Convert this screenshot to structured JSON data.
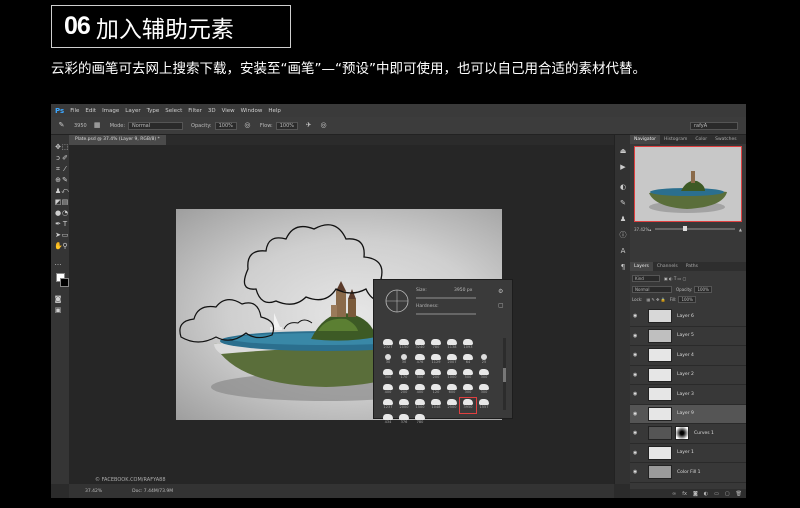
{
  "header": {
    "step_number": "06",
    "step_title": "加入辅助元素",
    "description": "云彩的画笔可去网上搜索下载，安装至“画笔”—“预设”中即可使用，也可以自己用合适的素材代替。"
  },
  "ps": {
    "logo": "Ps",
    "menu": [
      "File",
      "Edit",
      "Image",
      "Layer",
      "Type",
      "Select",
      "Filter",
      "3D",
      "View",
      "Window",
      "Help"
    ],
    "options": {
      "brush_size": "3950",
      "mode_label": "Mode:",
      "mode_value": "Normal",
      "opacity_label": "Opacity:",
      "opacity_value": "100%",
      "flow_label": "Flow:",
      "flow_value": "100%",
      "workspace": "rafyA"
    },
    "doc_tab": "Plate.psd @ 37.4% (Layer 9, RGB/8) *",
    "status": {
      "zoom": "37.42%",
      "doc_info": "Doc: 7.44M/73.9M"
    },
    "watermark": "© FACEBOOK.COM/RAFYA88",
    "brush_panel": {
      "size_label": "Size:",
      "size_value": "3950 px",
      "hardness_label": "Hardness:",
      "top_row": [
        "2327",
        "1150",
        "3240",
        "780",
        "1138",
        "1093"
      ],
      "grid": [
        {
          "n": "30",
          "t": "dot"
        },
        {
          "n": "30",
          "t": "dot"
        },
        {
          "n": "476",
          "t": "cl"
        },
        {
          "n": "1129",
          "t": "cl"
        },
        {
          "n": "2007",
          "t": "cl"
        },
        {
          "n": "64",
          "t": "cl"
        },
        {
          "n": "25",
          "t": "dot"
        },
        {
          "n": "300",
          "t": "cl"
        },
        {
          "n": "170",
          "t": "cl"
        },
        {
          "n": "500",
          "t": "cl"
        },
        {
          "n": "200",
          "t": "cl"
        },
        {
          "n": "1000",
          "t": "cl"
        },
        {
          "n": "500",
          "t": "cl"
        },
        {
          "n": "300",
          "t": "cl"
        },
        {
          "n": "400",
          "t": "cl"
        },
        {
          "n": "200",
          "t": "cl"
        },
        {
          "n": "400",
          "t": "cl"
        },
        {
          "n": "120",
          "t": "cl"
        },
        {
          "n": "600",
          "t": "cl"
        },
        {
          "n": "300",
          "t": "cl"
        },
        {
          "n": "300",
          "t": "cl"
        },
        {
          "n": "1237",
          "t": "cl"
        },
        {
          "n": "2000",
          "t": "cl"
        },
        {
          "n": "1500",
          "t": "cl"
        },
        {
          "n": "1048",
          "t": "cl"
        },
        {
          "n": "2500",
          "t": "cl"
        },
        {
          "n": "3950",
          "t": "cl",
          "sel": true
        },
        {
          "n": "1557",
          "t": "cl"
        },
        {
          "n": "434",
          "t": "cl"
        },
        {
          "n": "376",
          "t": "cl"
        },
        {
          "n": "780",
          "t": "cl"
        }
      ]
    },
    "panels": {
      "nav_tabs": [
        "Navigator",
        "Histogram",
        "Color",
        "Swatches"
      ],
      "zoom": "37.42%",
      "layer_tabs": [
        "Layers",
        "Channels",
        "Paths"
      ],
      "kind_label": "Kind",
      "blend_mode": "Normal",
      "opacity_label": "Opacity:",
      "opacity_value": "100%",
      "lock_label": "Lock:",
      "fill_label": "Fill:",
      "fill_value": "100%",
      "layers": [
        {
          "name": "Layer 6",
          "thumb": "#d8d8d8"
        },
        {
          "name": "Layer 5",
          "thumb": "#bfbfbf"
        },
        {
          "name": "Layer 4",
          "thumb": "#e6e6e6"
        },
        {
          "name": "Layer 2",
          "thumb": "#e6e6e6"
        },
        {
          "name": "Layer 3",
          "thumb": "#e6e6e6"
        },
        {
          "name": "Layer 9",
          "thumb": "#e6e6e6",
          "active": true
        },
        {
          "name": "Curves 1",
          "thumb": "#555555",
          "mask": true
        },
        {
          "name": "Layer 1",
          "thumb": "#e6e6e6"
        },
        {
          "name": "Color Fill 1",
          "thumb": "#9a9a9a"
        }
      ]
    }
  }
}
